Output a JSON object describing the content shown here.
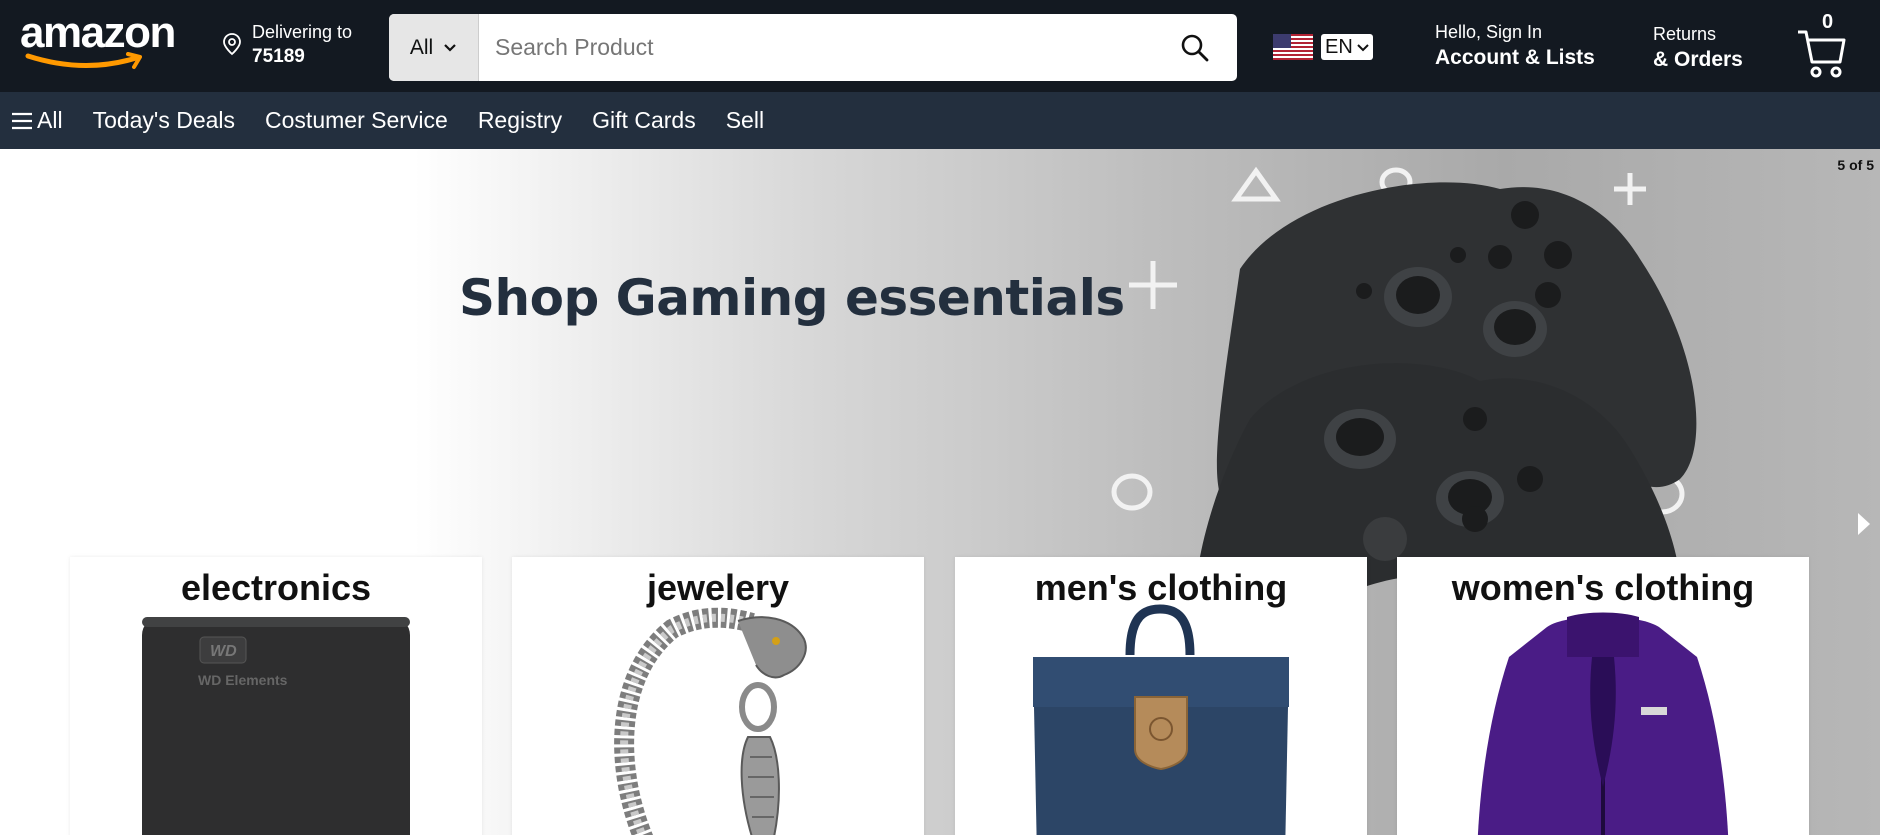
{
  "header": {
    "logo_text": "amazon",
    "deliver": {
      "line1": "Delivering to",
      "zip": "75189"
    },
    "search": {
      "category": "All",
      "placeholder": "Search Product"
    },
    "language": {
      "code": "EN",
      "flag": "us-flag-icon"
    },
    "account": {
      "line1": "Hello, Sign In",
      "line2": "Account & Lists"
    },
    "orders": {
      "line1": "Returns",
      "line2": "& Orders"
    },
    "cart": {
      "count": "0"
    }
  },
  "nav": {
    "items": [
      "All",
      "Today's Deals",
      "Costumer Service",
      "Registry",
      "Gift Cards",
      "Sell"
    ]
  },
  "hero": {
    "headline": "Shop Gaming essentials",
    "counter": "5 of 5"
  },
  "categories": [
    {
      "title": "electronics",
      "image": "external-hard-drive"
    },
    {
      "title": "jewelery",
      "image": "silver-dragon-bracelet"
    },
    {
      "title": "men's clothing",
      "image": "navy-backpack"
    },
    {
      "title": "women's clothing",
      "image": "purple-jacket"
    }
  ],
  "product_labels": {
    "hdd_brand": "WD",
    "hdd_model": "WD Elements"
  },
  "colors": {
    "header_bg": "#131921",
    "nav_bg": "#232f3e",
    "logo_smile": "#ff9900",
    "headline": "#232f3e"
  }
}
